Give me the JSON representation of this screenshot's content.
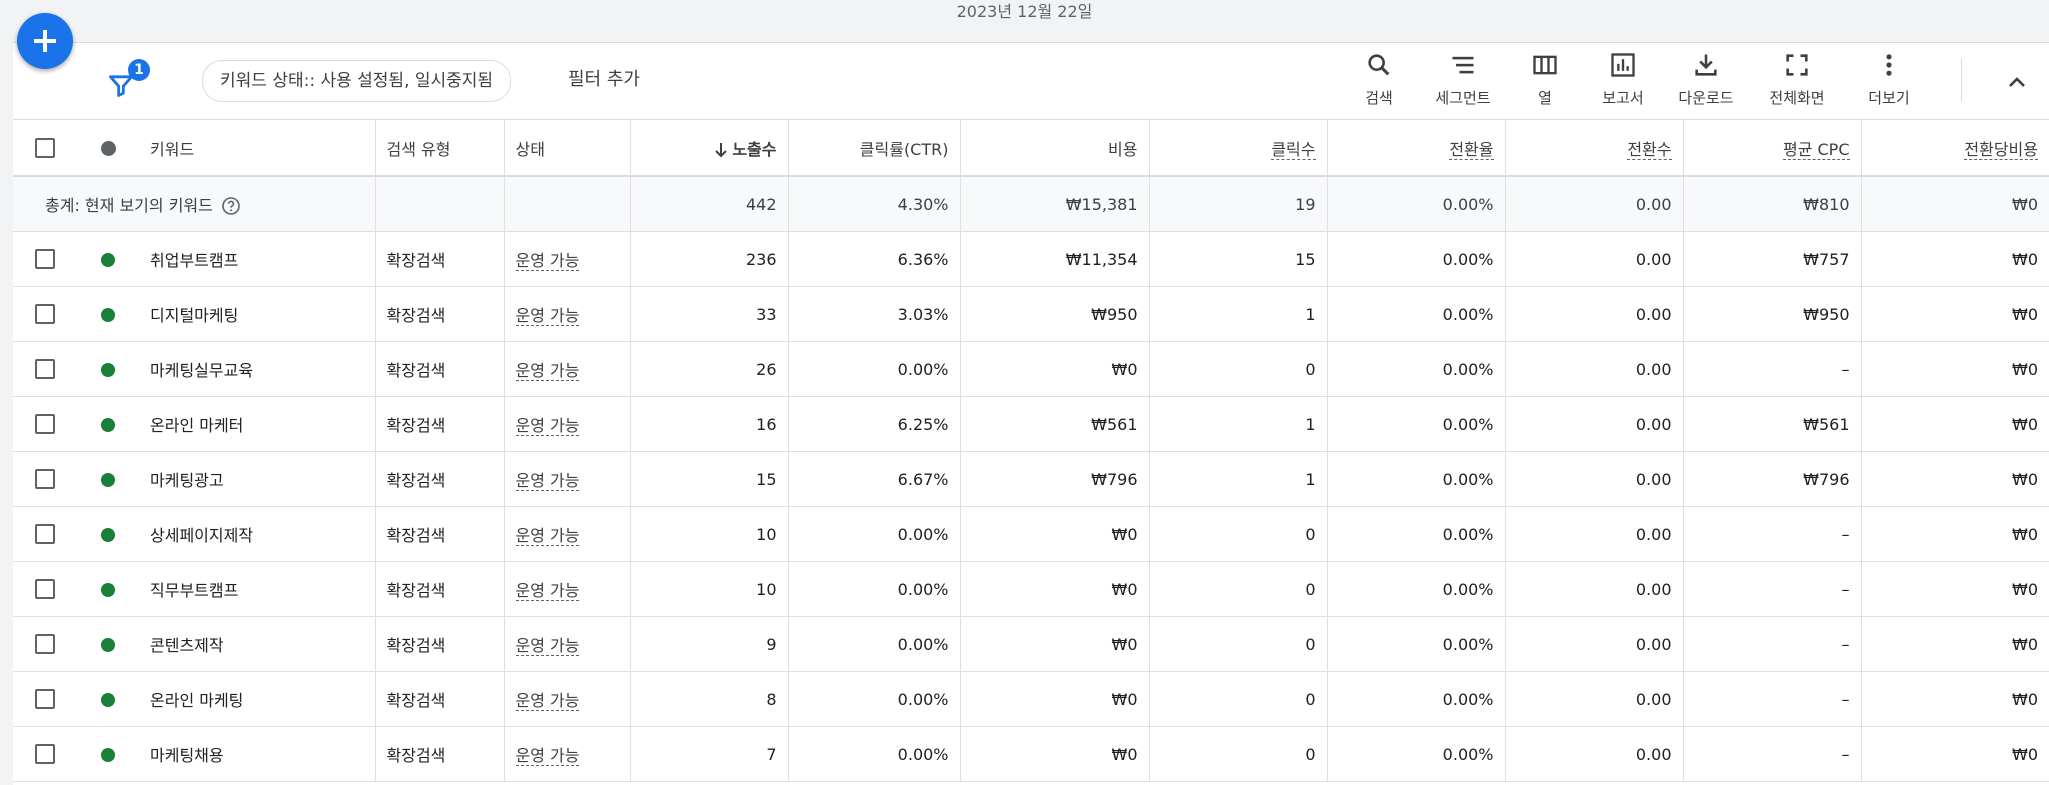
{
  "date_label": "2023년 12월 22일",
  "filter": {
    "badge": "1",
    "chip": "키워드 상태:: 사용 설정됨, 일시중지됨",
    "add_filter": "필터 추가"
  },
  "toolbar": {
    "search": "검색",
    "segment": "세그먼트",
    "columns": "열",
    "reports": "보고서",
    "download": "다운로드",
    "fullscreen": "전체화면",
    "more": "더보기"
  },
  "columns": {
    "keyword": "키워드",
    "match_type": "검색 유형",
    "status": "상태",
    "impressions": "노출수",
    "ctr": "클릭률(CTR)",
    "cost": "비용",
    "clicks": "클릭수",
    "conv_rate": "전환율",
    "conversions": "전환수",
    "avg_cpc": "평균 CPC",
    "cost_per_conv": "전환당비용"
  },
  "total": {
    "label": "총계: 현재 보기의 키워드",
    "impressions": "442",
    "ctr": "4.30%",
    "cost": "₩15,381",
    "clicks": "19",
    "conv_rate": "0.00%",
    "conversions": "0.00",
    "avg_cpc": "₩810",
    "cost_per_conv": "₩0"
  },
  "rows": [
    {
      "keyword": "취업부트캠프",
      "match": "확장검색",
      "status": "운영 가능",
      "impressions": "236",
      "ctr": "6.36%",
      "cost": "₩11,354",
      "clicks": "15",
      "conv_rate": "0.00%",
      "conversions": "0.00",
      "avg_cpc": "₩757",
      "cpa": "₩0"
    },
    {
      "keyword": "디지털마케팅",
      "match": "확장검색",
      "status": "운영 가능",
      "impressions": "33",
      "ctr": "3.03%",
      "cost": "₩950",
      "clicks": "1",
      "conv_rate": "0.00%",
      "conversions": "0.00",
      "avg_cpc": "₩950",
      "cpa": "₩0"
    },
    {
      "keyword": "마케팅실무교육",
      "match": "확장검색",
      "status": "운영 가능",
      "impressions": "26",
      "ctr": "0.00%",
      "cost": "₩0",
      "clicks": "0",
      "conv_rate": "0.00%",
      "conversions": "0.00",
      "avg_cpc": "–",
      "cpa": "₩0"
    },
    {
      "keyword": "온라인 마케터",
      "match": "확장검색",
      "status": "운영 가능",
      "impressions": "16",
      "ctr": "6.25%",
      "cost": "₩561",
      "clicks": "1",
      "conv_rate": "0.00%",
      "conversions": "0.00",
      "avg_cpc": "₩561",
      "cpa": "₩0"
    },
    {
      "keyword": "마케팅광고",
      "match": "확장검색",
      "status": "운영 가능",
      "impressions": "15",
      "ctr": "6.67%",
      "cost": "₩796",
      "clicks": "1",
      "conv_rate": "0.00%",
      "conversions": "0.00",
      "avg_cpc": "₩796",
      "cpa": "₩0"
    },
    {
      "keyword": "상세페이지제작",
      "match": "확장검색",
      "status": "운영 가능",
      "impressions": "10",
      "ctr": "0.00%",
      "cost": "₩0",
      "clicks": "0",
      "conv_rate": "0.00%",
      "conversions": "0.00",
      "avg_cpc": "–",
      "cpa": "₩0"
    },
    {
      "keyword": "직무부트캠프",
      "match": "확장검색",
      "status": "운영 가능",
      "impressions": "10",
      "ctr": "0.00%",
      "cost": "₩0",
      "clicks": "0",
      "conv_rate": "0.00%",
      "conversions": "0.00",
      "avg_cpc": "–",
      "cpa": "₩0"
    },
    {
      "keyword": "콘텐츠제작",
      "match": "확장검색",
      "status": "운영 가능",
      "impressions": "9",
      "ctr": "0.00%",
      "cost": "₩0",
      "clicks": "0",
      "conv_rate": "0.00%",
      "conversions": "0.00",
      "avg_cpc": "–",
      "cpa": "₩0"
    },
    {
      "keyword": "온라인 마케팅",
      "match": "확장검색",
      "status": "운영 가능",
      "impressions": "8",
      "ctr": "0.00%",
      "cost": "₩0",
      "clicks": "0",
      "conv_rate": "0.00%",
      "conversions": "0.00",
      "avg_cpc": "–",
      "cpa": "₩0"
    },
    {
      "keyword": "마케팅채용",
      "match": "확장검색",
      "status": "운영 가능",
      "impressions": "7",
      "ctr": "0.00%",
      "cost": "₩0",
      "clicks": "0",
      "conv_rate": "0.00%",
      "conversions": "0.00",
      "avg_cpc": "–",
      "cpa": "₩0"
    }
  ]
}
